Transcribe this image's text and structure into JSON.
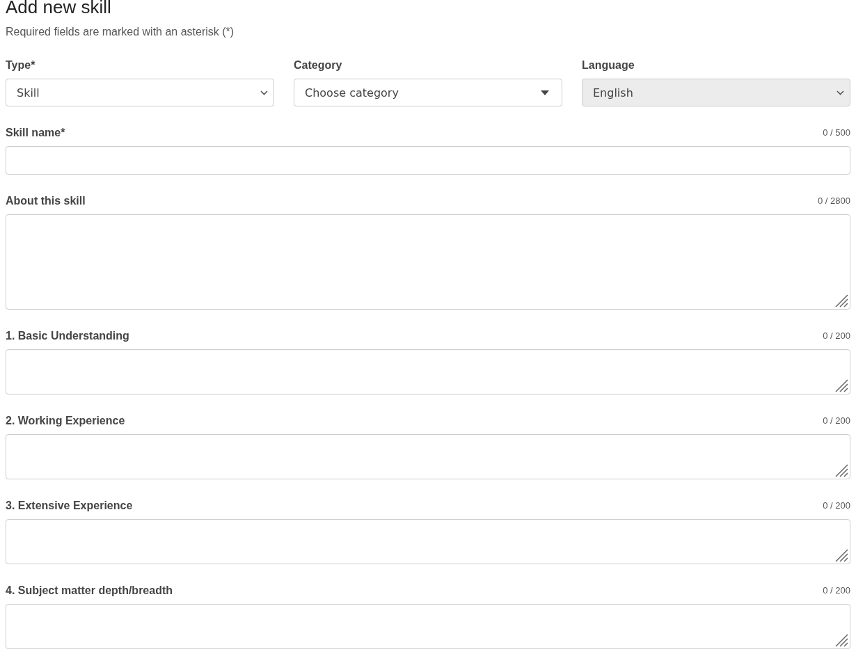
{
  "title": "Add new skill",
  "subtitle": "Required fields are marked with an asterisk (*)",
  "selects": [
    {
      "label": "Type*",
      "value": "Skill",
      "kind": "native",
      "disabled": false
    },
    {
      "label": "Category",
      "value": "Choose category",
      "kind": "dropdown",
      "disabled": false
    },
    {
      "label": "Language",
      "value": "English",
      "kind": "native",
      "disabled": true
    }
  ],
  "fields": [
    {
      "label": "Skill name*",
      "counter": "0 / 500",
      "kind": "input"
    },
    {
      "label": "About this skill",
      "counter": "0 / 2800",
      "kind": "long-text"
    },
    {
      "label": "1. Basic Understanding",
      "counter": "0 / 200",
      "kind": "textarea"
    },
    {
      "label": "2. Working Experience",
      "counter": "0 / 200",
      "kind": "textarea"
    },
    {
      "label": "3. Extensive Experience",
      "counter": "0 / 200",
      "kind": "textarea"
    },
    {
      "label": "4. Subject matter depth/breadth",
      "counter": "0 / 200",
      "kind": "textarea"
    }
  ]
}
